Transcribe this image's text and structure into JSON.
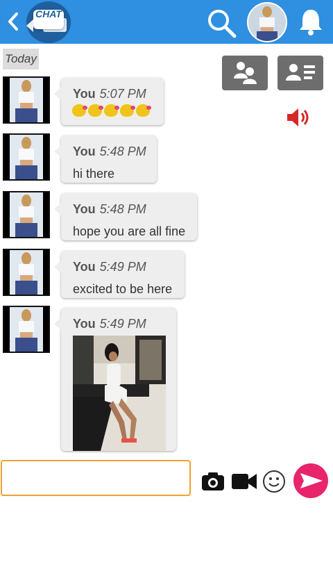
{
  "header": {
    "logo_text": "CHAT",
    "back_icon": "chevron-left-icon",
    "search_icon": "search-icon",
    "bell_icon": "bell-icon"
  },
  "day_label": "Today",
  "messages": [
    {
      "sender": "You",
      "time": "5:07 PM",
      "text": "",
      "emoji_count": 5
    },
    {
      "sender": "You",
      "time": "5:48 PM",
      "text": "hi there"
    },
    {
      "sender": "You",
      "time": "5:48 PM",
      "text": "hope you are all fine"
    },
    {
      "sender": "You",
      "time": "5:49 PM",
      "text": "excited to be here"
    },
    {
      "sender": "You",
      "time": "5:49 PM",
      "text": "",
      "has_photo": true
    }
  ],
  "composer": {
    "input_value": "",
    "placeholder": ""
  },
  "colors": {
    "header": "#2f8fe0",
    "input_border": "#f0a030",
    "send_button": "#e8256a",
    "speaker": "#d62828"
  }
}
